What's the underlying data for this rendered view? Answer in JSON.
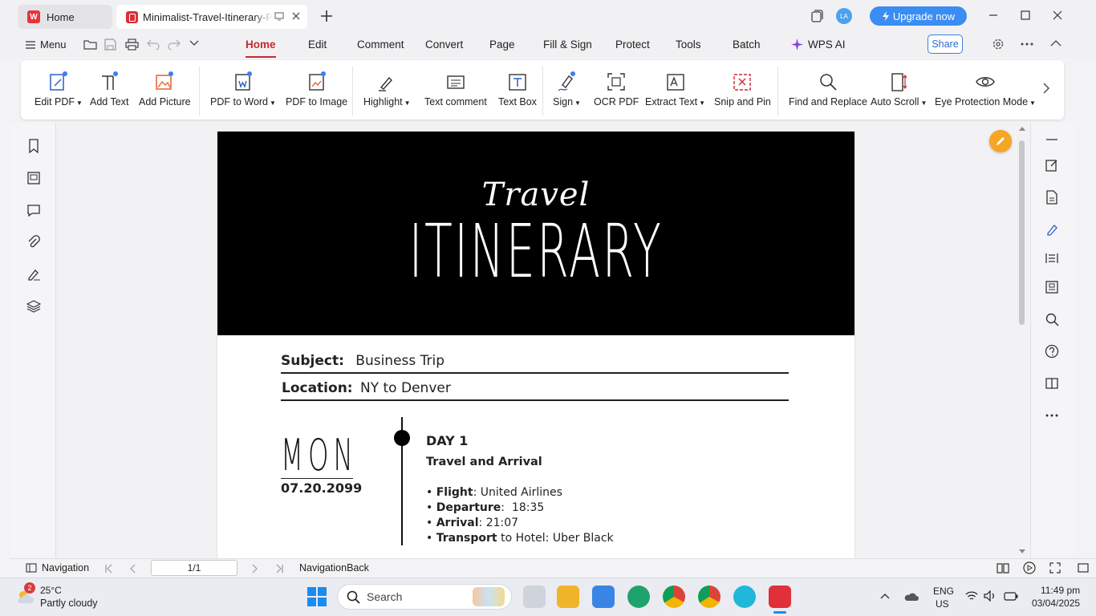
{
  "titlebar": {
    "tabs": [
      {
        "label": "Home",
        "icon": "wps-logo-icon"
      },
      {
        "label": "Minimalist-Travel-Itinerary-Planner.pdf",
        "icon": "pdf-icon"
      }
    ],
    "avatar": "LA",
    "upgrade_label": "Upgrade now"
  },
  "menubar": {
    "menu_label": "Menu",
    "tabs": [
      "Home",
      "Edit",
      "Comment",
      "Convert",
      "Page",
      "Fill & Sign",
      "Protect",
      "Tools",
      "Batch"
    ],
    "active_tab": "Home",
    "wps_ai": "WPS AI",
    "share": "Share"
  },
  "ribbon": {
    "items": [
      {
        "label": "Edit PDF",
        "dropdown": true
      },
      {
        "label": "Add Text"
      },
      {
        "label": "Add Picture"
      },
      {
        "label": "PDF to Word",
        "dropdown": true
      },
      {
        "label": "PDF to Image"
      },
      {
        "label": "Highlight",
        "dropdown": true
      },
      {
        "label": "Text comment"
      },
      {
        "label": "Text Box"
      },
      {
        "label": "Sign",
        "dropdown": true
      },
      {
        "label": "OCR PDF"
      },
      {
        "label": "Extract Text",
        "dropdown": true
      },
      {
        "label": "Snip and Pin"
      },
      {
        "label": "Find and Replace"
      },
      {
        "label": "Auto Scroll",
        "dropdown": true
      },
      {
        "label": "Eye Protection Mode",
        "dropdown": true
      }
    ]
  },
  "document": {
    "script_title": "Travel",
    "title": "ITINERARY",
    "subject_label": "Subject:",
    "subject_value": "Business Trip",
    "location_label": "Location:",
    "location_value": "NY to Denver",
    "weekday": "MON",
    "date": "07.20.2099",
    "day_title": "DAY 1",
    "day_subtitle": "Travel and Arrival",
    "bullets": [
      {
        "key": "Flight",
        "sep": ": ",
        "value": "United Airlines"
      },
      {
        "key": "Departure",
        "sep": ":  ",
        "value": "18:35"
      },
      {
        "key": "Arrival",
        "sep": ": ",
        "value": "21:07"
      },
      {
        "key": "Transport",
        "sep": " ",
        "value": "to Hotel: Uber Black"
      }
    ]
  },
  "statusbar": {
    "navigation": "Navigation",
    "page": "1/1",
    "nav_back": "NavigationBack"
  },
  "taskbar": {
    "weather_temp": "25°C",
    "weather_desc": "Partly cloudy",
    "weather_badge": "2",
    "search_placeholder": "Search",
    "lang": "ENG",
    "region": "US",
    "time": "11:49 pm",
    "date": "03/04/2025"
  },
  "colors": {
    "accent_red": "#c8282f",
    "upgrade_blue": "#3a8df3",
    "edit_fab": "#f5a623",
    "banner": "#000000"
  }
}
